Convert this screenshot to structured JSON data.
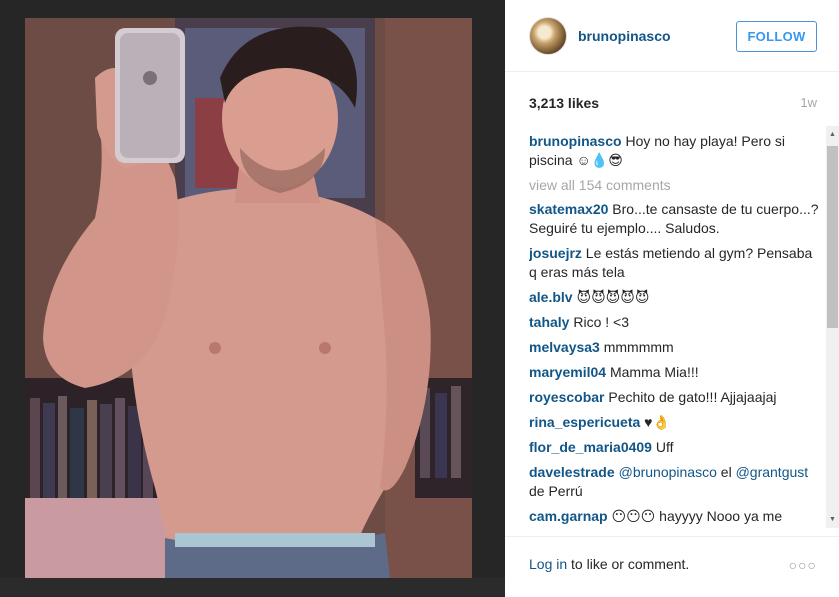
{
  "header": {
    "username": "brunopinasco",
    "follow_label": "FOLLOW"
  },
  "stats": {
    "likes": "3,213 likes",
    "age": "1w"
  },
  "caption": {
    "username": "brunopinasco",
    "text": " Hoy no hay playa! Pero si piscina ☺💧😎"
  },
  "view_all": "view all 154 comments",
  "comments": [
    {
      "user": "skatemax20",
      "text": " Bro...te cansaste de tu cuerpo...? Seguiré tu ejemplo.... Saludos."
    },
    {
      "user": "josuejrz",
      "text": " Le estás metiendo al gym? Pensaba q eras más tela"
    },
    {
      "user": "ale.blv",
      "text": " 😈😈😈😈😈"
    },
    {
      "user": "tahaly",
      "text": " Rico ! <3"
    },
    {
      "user": "melvaysa3",
      "text": " mmmmmm"
    },
    {
      "user": "maryemil04",
      "text": " Mamma Mia!!!"
    },
    {
      "user": "royescobar",
      "text": " Pechito de gato!!! Ajjajaajaj"
    },
    {
      "user": "rina_espericueta",
      "text": " ♥👌"
    },
    {
      "user": "flor_de_maria0409",
      "text": " Uff"
    },
    {
      "user": "davelestrade",
      "mention1": "@brunopinasco",
      "mid": " el ",
      "mention2": "@grantgust",
      "tail": " de Perrú"
    },
    {
      "user": "cam.garnap",
      "text": " 😶😶😶 hayyyy Nooo ya me"
    }
  ],
  "footer": {
    "login_link": "Log in",
    "login_rest": " to like or comment."
  },
  "icons": {
    "more": "more-options-icon",
    "scroll_up": "scroll-up-arrow-icon",
    "scroll_down": "scroll-down-arrow-icon"
  }
}
